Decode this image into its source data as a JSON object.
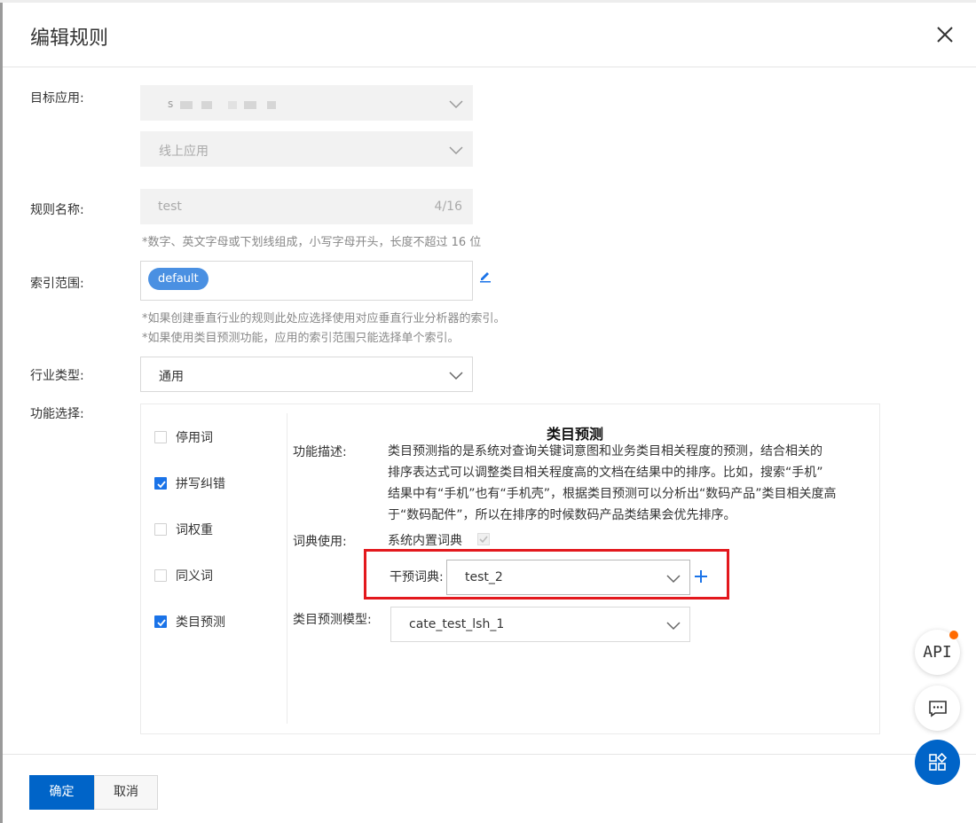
{
  "dialog": {
    "title": "编辑规则"
  },
  "form": {
    "target_app": {
      "label": "目标应用:",
      "app_value": "s",
      "env_value": "线上应用"
    },
    "rule_name": {
      "label": "规则名称:",
      "value": "test",
      "counter": "4/16",
      "hint": "*数字、英文字母或下划线组成，小写字母开头，长度不超过 16 位"
    },
    "index_scope": {
      "label": "索引范围:",
      "tags": [
        "default"
      ],
      "hints": [
        "*如果创建垂直行业的规则此处应选择使用对应垂直行业分析器的索引。",
        "*如果使用类目预测功能，应用的索引范围只能选择单个索引。"
      ]
    },
    "industry_type": {
      "label": "行业类型:",
      "value": "通用"
    },
    "features": {
      "label": "功能选择:",
      "items": [
        {
          "label": "停用词",
          "checked": false
        },
        {
          "label": "拼写纠错",
          "checked": true
        },
        {
          "label": "词权重",
          "checked": false
        },
        {
          "label": "同义词",
          "checked": false
        },
        {
          "label": "类目预测",
          "checked": true
        }
      ]
    }
  },
  "detail": {
    "title": "类目预测",
    "desc_label": "功能描述:",
    "desc_lines": [
      "类目预测指的是系统对查询关键词意图和业务类目相关程度的预测，结合相关的",
      "排序表达式可以调整类目相关程度高的文档在结果中的排序。比如，搜索“手机”",
      "结果中有“手机”也有“手机壳”，根据类目预测可以分析出“数码产品”类目相关度高",
      "于“数码配件”，所以在排序的时候数码产品类结果会优先排序。"
    ],
    "dict_label": "词典使用:",
    "system_dict": "系统内置词典",
    "intervene_label": "干预词典:",
    "intervene_value": "test_2",
    "model_label": "类目预测模型:",
    "model_value": "cate_test_lsh_1"
  },
  "footer": {
    "confirm": "确定",
    "cancel": "取消"
  },
  "floating": {
    "api_label": "API"
  },
  "colors": {
    "primary": "#0064c8",
    "tag": "#4a90e2",
    "highlight": "#e3181d",
    "notify": "#ff6a00"
  }
}
